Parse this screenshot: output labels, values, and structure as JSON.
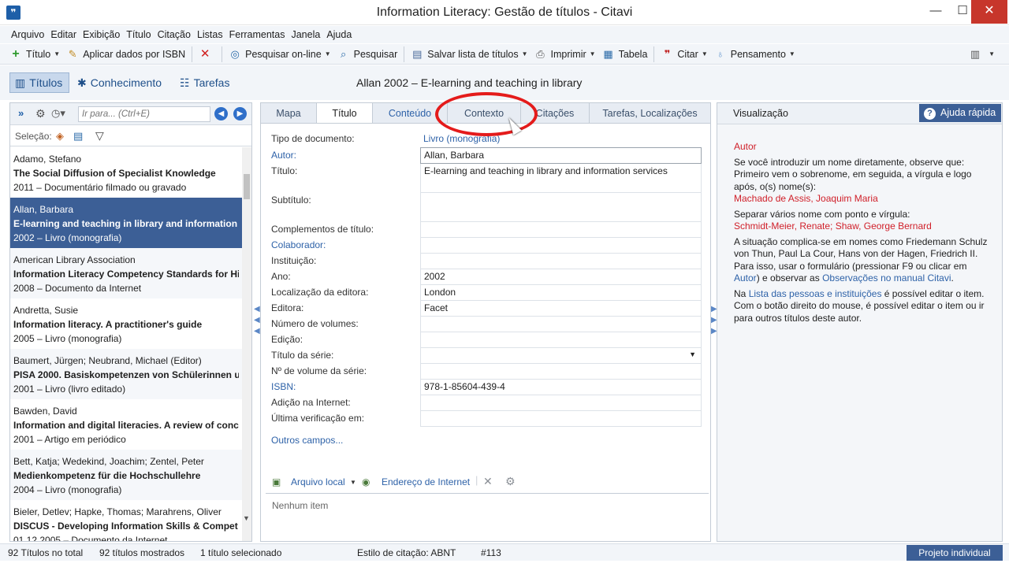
{
  "window": {
    "title": "Information Literacy: Gestão de títulos - Citavi",
    "minimize": "—",
    "maximize": "☐",
    "close": "✕",
    "app_icon": "❞"
  },
  "menu": [
    "Arquivo",
    "Editar",
    "Exibição",
    "Título",
    "Citação",
    "Listas",
    "Ferramentas",
    "Janela",
    "Ajuda"
  ],
  "toolbar": {
    "titulo": "Título",
    "isbn": "Aplicar dados por ISBN",
    "search_online": "Pesquisar on-line",
    "search": "Pesquisar",
    "save_list": "Salvar lista de títulos",
    "print": "Imprimir",
    "table": "Tabela",
    "cite": "Citar",
    "thought": "Pensamento"
  },
  "modes": {
    "titulos": "Títulos",
    "conhecimento": "Conhecimento",
    "tarefas": "Tarefas"
  },
  "current_reference": "Allan 2002 – E-learning and teaching in library",
  "left_panel": {
    "goto_placeholder": "Ir para... (Ctrl+E)",
    "selection_label": "Seleção:",
    "titles": [
      {
        "author": "Adamo, Stefano",
        "title": "The Social Diffusion of Specialist Knowledge",
        "meta": "2011 – Documentário filmado ou gravado"
      },
      {
        "author": "Allan, Barbara",
        "title": "E-learning and teaching in library and information s",
        "meta": "2002 – Livro (monografia)"
      },
      {
        "author": "American Library Association",
        "title": "Information Literacy Competency Standards for Hi",
        "meta": "2008 – Documento da Internet"
      },
      {
        "author": "Andretta, Susie",
        "title": "Information literacy. A practitioner's guide",
        "meta": "2005 – Livro (monografia)"
      },
      {
        "author": "Baumert, Jürgen; Neubrand, Michael (Editor)",
        "title": "PISA 2000. Basiskompetenzen von Schülerinnen un",
        "meta": "2001 – Livro (livro editado)"
      },
      {
        "author": "Bawden, David",
        "title": "Information and digital literacies. A review of conc",
        "meta": "2001 – Artigo em periódico"
      },
      {
        "author": "Bett, Katja; Wedekind, Joachim; Zentel, Peter",
        "title": "Medienkompetenz für die Hochschullehre",
        "meta": "2004 – Livro (monografia)"
      },
      {
        "author": "Bieler, Detlev; Hapke, Thomas; Marahrens, Oliver",
        "title": "DISCUS - Developing Information Skills & Compet",
        "meta": "01.12.2005 – Documento da Internet"
      }
    ]
  },
  "status": {
    "total": "92 Títulos no total",
    "shown": "92 títulos mostrados",
    "selected": "1 título selecionado",
    "style": "Estilo de citação: ABNT",
    "number": "#113",
    "project": "Projeto individual"
  },
  "tabs": [
    "Mapa",
    "Título",
    "Conteúdo",
    "Contexto",
    "Citações",
    "Tarefas, Localizações"
  ],
  "editor": {
    "doc_type_label": "Tipo de documento:",
    "doc_type_value": "Livro (monografia)",
    "fields": [
      {
        "label": "Autor:",
        "value": "Allan, Barbara"
      },
      {
        "label": "Título:",
        "value": "E-learning and teaching in library and information services"
      },
      {
        "label": "Subtítulo:",
        "value": ""
      },
      {
        "label": "Complementos de título:",
        "value": ""
      },
      {
        "label": "Colaborador:",
        "value": ""
      },
      {
        "label": "Instituição:",
        "value": ""
      },
      {
        "label": "Ano:",
        "value": "2002"
      },
      {
        "label": "Localização da editora:",
        "value": "London"
      },
      {
        "label": "Editora:",
        "value": "Facet"
      },
      {
        "label": "Número de volumes:",
        "value": ""
      },
      {
        "label": "Edição:",
        "value": ""
      },
      {
        "label": "Título da série:",
        "value": ""
      },
      {
        "label": "Nº de volume da série:",
        "value": ""
      },
      {
        "label": "ISBN:",
        "value": "978-1-85604-439-4"
      },
      {
        "label": "Adição na Internet:",
        "value": ""
      },
      {
        "label": "Última verificação em:",
        "value": ""
      }
    ],
    "more_fields": "Outros campos...",
    "local_file": "Arquivo local",
    "internet_address": "Endereço de Internet",
    "no_items": "Nenhum item"
  },
  "help_panel": {
    "title": "Visualização",
    "help_button": "Ajuda rápida",
    "heading": "Autor",
    "p1": "Se você introduzir um nome diretamente, observe que: Primeiro vem o sobrenome, em seguida, a vírgula e logo após, o(s) nome(s):",
    "ex1": "Machado de Assis, Joaquim Maria",
    "p2": "Separar vários nome com ponto e vírgula:",
    "ex2": "Schmidt-Meier, Renate; Shaw, George Bernard",
    "p3": "A situação complica-se em nomes como Friedemann Schulz von Thun, Paul La Cour, Hans von der Hagen, Friedrich II. Para isso, usar o formulário (pressionar F9 ou clicar em",
    "p3_link1": "Autor",
    "p3_mid": ") e observar as",
    "p3_link2": "Observações no manual Citavi",
    "p3_end": ".",
    "p4_start": "Na",
    "p4_link": "Lista das pessoas e instituições",
    "p4_end": " é possível editar o item. Com o botão direito do mouse, é possível editar o item ou ir para outros títulos deste autor."
  },
  "icons": {
    "plus": "plus-icon",
    "wand": "wand-icon",
    "delete": "x-icon",
    "globe-search": "globe-search-icon",
    "search": "magnifier-icon",
    "save": "save-list-icon",
    "print": "printer-icon",
    "table": "table-icon",
    "cite": "quote-icon",
    "bulb": "lightbulb-icon"
  },
  "colors": {
    "accent": "#3c5f96",
    "link": "#2e62a8",
    "highlight": "#e41b1b",
    "red_text": "#d0202a"
  }
}
